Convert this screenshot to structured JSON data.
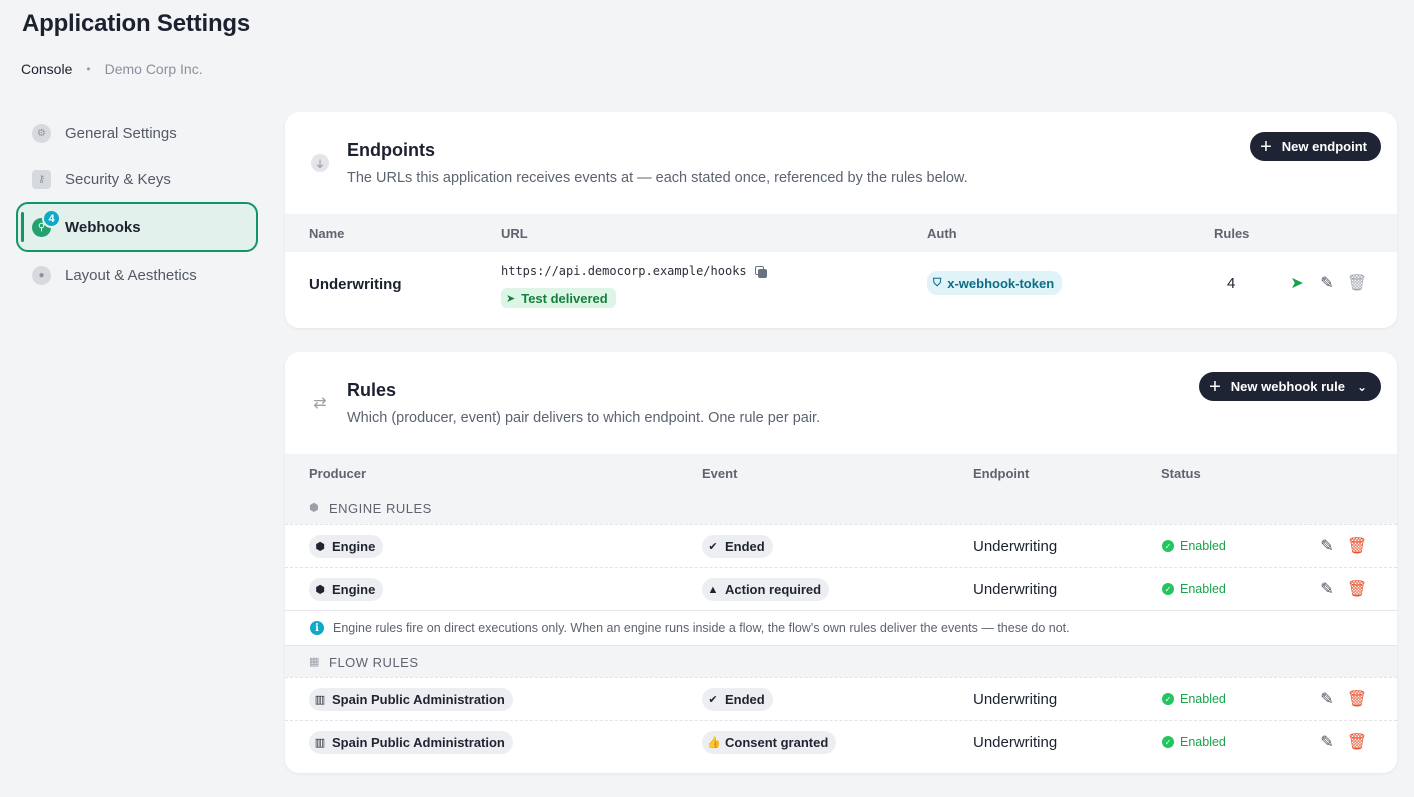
{
  "header": {
    "title": "Application Settings",
    "breadcrumb": [
      "Console",
      "Demo Corp Inc."
    ]
  },
  "sidebar": {
    "items": [
      {
        "label": "General Settings",
        "icon": "gear-icon"
      },
      {
        "label": "Security & Keys",
        "icon": "key-icon"
      },
      {
        "label": "Webhooks",
        "icon": "webhook-icon",
        "badge": "4",
        "active": true
      },
      {
        "label": "Layout & Aesthetics",
        "icon": "palette-icon"
      }
    ]
  },
  "endpoints": {
    "title": "Endpoints",
    "subtitle": "The URLs this application receives events at — each stated once, referenced by the rules below.",
    "new_button": "New endpoint",
    "columns": [
      "Name",
      "URL",
      "Auth",
      "Rules"
    ],
    "rows": [
      {
        "name": "Underwriting",
        "url": "https://api.democorp.example/hooks",
        "test_status": "Test delivered",
        "auth": "x-webhook-token",
        "rules": "4"
      }
    ]
  },
  "rules": {
    "title": "Rules",
    "subtitle": "Which (producer, event) pair delivers to which endpoint. One rule per pair.",
    "new_button": "New webhook rule",
    "columns": [
      "Producer",
      "Event",
      "Endpoint",
      "Status"
    ],
    "engine_section": "ENGINE RULES",
    "flow_section": "FLOW RULES",
    "engine_rows": [
      {
        "producer": "Engine",
        "event": "Ended",
        "endpoint": "Underwriting",
        "status": "Enabled"
      },
      {
        "producer": "Engine",
        "event": "Action required",
        "endpoint": "Underwriting",
        "status": "Enabled"
      }
    ],
    "note": "Engine rules fire on direct executions only. When an engine runs inside a flow, the flow's own rules deliver the events — these do not.",
    "flow_rows": [
      {
        "producer": "Spain Public Administration",
        "event": "Ended",
        "endpoint": "Underwriting",
        "status": "Enabled"
      },
      {
        "producer": "Spain Public Administration",
        "event": "Consent granted",
        "endpoint": "Underwriting",
        "status": "Enabled"
      }
    ]
  },
  "colors": {
    "accent_green": "#139468",
    "dark_button": "#1e2433",
    "delete_red": "#e5532f",
    "status_green": "#16a34a"
  }
}
